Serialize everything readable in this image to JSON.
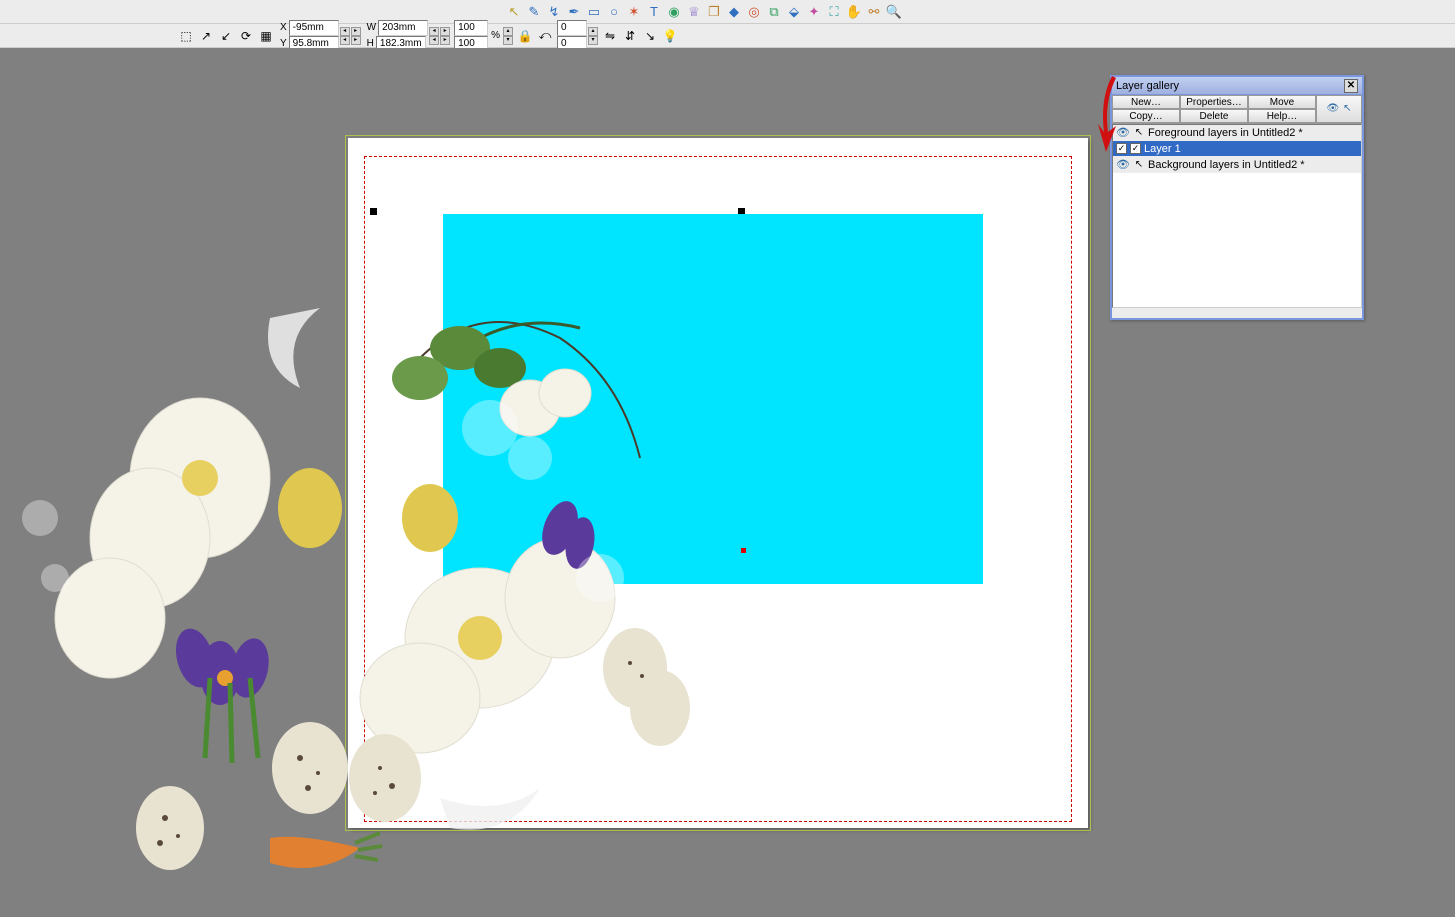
{
  "toolbar": {
    "tools": [
      {
        "name": "selector-tool",
        "glyph": "↖",
        "color": "#b8a030"
      },
      {
        "name": "freehand-tool",
        "glyph": "✎",
        "color": "#3070c0"
      },
      {
        "name": "shape-editor-tool",
        "glyph": "↯",
        "color": "#3070c0"
      },
      {
        "name": "pen-tool",
        "glyph": "✒",
        "color": "#3070c0"
      },
      {
        "name": "rectangle-tool",
        "glyph": "▭",
        "color": "#3070c0"
      },
      {
        "name": "ellipse-tool",
        "glyph": "○",
        "color": "#3070c0"
      },
      {
        "name": "quickshape-tool",
        "glyph": "✶",
        "color": "#d05030"
      },
      {
        "name": "text-tool",
        "glyph": "T",
        "color": "#3070c0"
      },
      {
        "name": "fill-tool",
        "glyph": "◉",
        "color": "#30a060"
      },
      {
        "name": "transparency-tool",
        "glyph": "♕",
        "color": "#8060c0"
      },
      {
        "name": "shadow-tool",
        "glyph": "❐",
        "color": "#c08030"
      },
      {
        "name": "bevel-tool",
        "glyph": "◆",
        "color": "#3070c0"
      },
      {
        "name": "contour-tool",
        "glyph": "◎",
        "color": "#d05030"
      },
      {
        "name": "blend-tool",
        "glyph": "⧉",
        "color": "#30a060"
      },
      {
        "name": "mould-tool",
        "glyph": "⬙",
        "color": "#3070c0"
      },
      {
        "name": "liveeffect-tool",
        "glyph": "✦",
        "color": "#c050a0"
      },
      {
        "name": "photo-tool",
        "glyph": "⛶",
        "color": "#30a0a0"
      },
      {
        "name": "push-tool",
        "glyph": "✋",
        "color": "#c08030"
      },
      {
        "name": "link-tool",
        "glyph": "⚯",
        "color": "#c08030"
      },
      {
        "name": "zoom-tool",
        "glyph": "🔍",
        "color": "#3070c0"
      }
    ]
  },
  "infobar": {
    "x_label": "X",
    "y_label": "Y",
    "w_label": "W",
    "h_label": "H",
    "x_value": "-95mm",
    "y_value": "95.8mm",
    "w_value": "203mm",
    "h_value": "182.3mm",
    "scale_x": "100",
    "scale_y": "100",
    "pct": "%",
    "angle": "0",
    "skew": "0"
  },
  "layer_gallery": {
    "title": "Layer gallery",
    "btn_new": "New…",
    "btn_props": "Properties…",
    "btn_move": "Move",
    "btn_copy": "Copy…",
    "btn_delete": "Delete",
    "btn_help": "Help…",
    "row_fg": "Foreground layers in Untitled2 *",
    "row_layer1": "Layer 1",
    "row_bg": "Background layers in Untitled2 *"
  }
}
